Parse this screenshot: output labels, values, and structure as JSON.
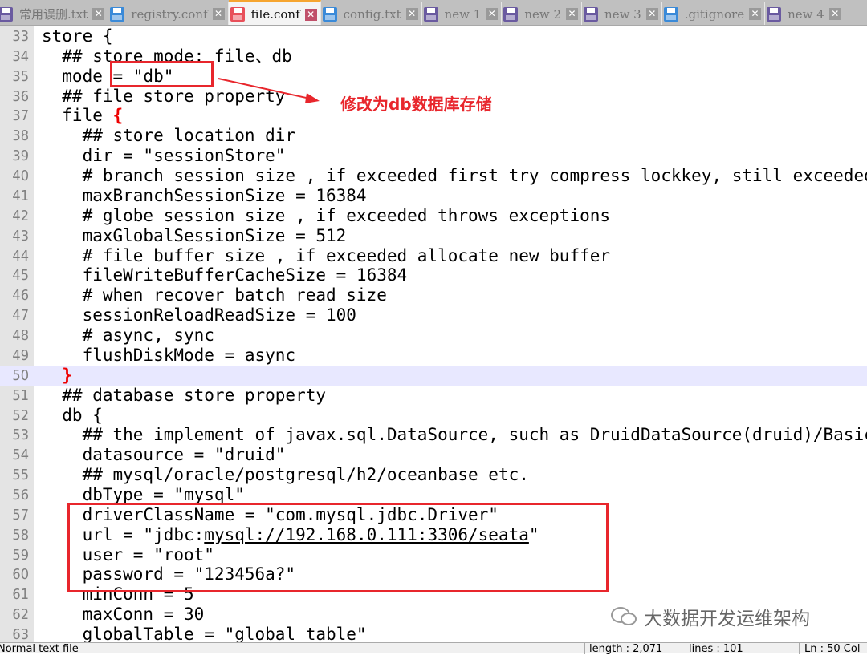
{
  "tabs": [
    {
      "label": "常用误删.txt",
      "color": "#6a5aa0",
      "active": false
    },
    {
      "label": "registry.conf",
      "color": "#3a8ad8",
      "active": false
    },
    {
      "label": "file.conf",
      "color": "#e8505a",
      "active": true
    },
    {
      "label": "config.txt",
      "color": "#3a8ad8",
      "active": false
    },
    {
      "label": "new 1",
      "color": "#6a5aa0",
      "active": false
    },
    {
      "label": "new 2",
      "color": "#6a5aa0",
      "active": false
    },
    {
      "label": "new 3",
      "color": "#6a5aa0",
      "active": false
    },
    {
      "label": ".gitignore",
      "color": "#3a8ad8",
      "active": false
    },
    {
      "label": "new 4",
      "color": "#6a5aa0",
      "active": false
    }
  ],
  "lines": [
    {
      "n": "33",
      "t": "store {"
    },
    {
      "n": "34",
      "t": "  ## store mode: file、db"
    },
    {
      "n": "35",
      "t": "  mode = \"db\""
    },
    {
      "n": "36",
      "t": "  ## file store property"
    },
    {
      "n": "37",
      "t": "  file ",
      "brace": "{"
    },
    {
      "n": "38",
      "t": "    ## store location dir"
    },
    {
      "n": "39",
      "t": "    dir = \"sessionStore\""
    },
    {
      "n": "40",
      "t": "    # branch session size , if exceeded first try compress lockkey, still exceeded throws exceptions"
    },
    {
      "n": "41",
      "t": "    maxBranchSessionSize = 16384"
    },
    {
      "n": "42",
      "t": "    # globe session size , if exceeded throws exceptions"
    },
    {
      "n": "43",
      "t": "    maxGlobalSessionSize = 512"
    },
    {
      "n": "44",
      "t": "    # file buffer size , if exceeded allocate new buffer"
    },
    {
      "n": "45",
      "t": "    fileWriteBufferCacheSize = 16384"
    },
    {
      "n": "46",
      "t": "    # when recover batch read size"
    },
    {
      "n": "47",
      "t": "    sessionReloadReadSize = 100"
    },
    {
      "n": "48",
      "t": "    # async, sync"
    },
    {
      "n": "49",
      "t": "    flushDiskMode = async"
    },
    {
      "n": "50",
      "t": "  ",
      "brace": "}",
      "current": true
    },
    {
      "n": "51",
      "t": "  ## database store property"
    },
    {
      "n": "52",
      "t": "  db {"
    },
    {
      "n": "53",
      "t": "    ## the implement of javax.sql.DataSource, such as DruidDataSource(druid)/BasicDataSource(dbcp) etc."
    },
    {
      "n": "54",
      "t": "    datasource = \"druid\""
    },
    {
      "n": "55",
      "t": "    ## mysql/oracle/postgresql/h2/oceanbase etc."
    },
    {
      "n": "56",
      "t": "    dbType = \"mysql\""
    },
    {
      "n": "57",
      "t": "    driverClassName = \"com.mysql.jdbc.Driver\""
    },
    {
      "n": "58",
      "t": "    url = \"jdbc:",
      "link": "mysql://192.168.0.111:3306/seata",
      "after": "\""
    },
    {
      "n": "59",
      "t": "    user = \"root\""
    },
    {
      "n": "60",
      "t": "    password = \"123456a?\""
    },
    {
      "n": "61",
      "t": "    minConn = 5"
    },
    {
      "n": "62",
      "t": "    maxConn = 30"
    },
    {
      "n": "63",
      "t": "    globalTable = \"global_table\""
    }
  ],
  "annotation": {
    "text": "修改为db数据库存储",
    "color": "#e8262c"
  },
  "watermark": "大数据开发运维架构",
  "status": {
    "type": "Normal text file",
    "length": "length : 2,071",
    "lines": "lines : 101",
    "pos": "Ln : 50    Col"
  }
}
